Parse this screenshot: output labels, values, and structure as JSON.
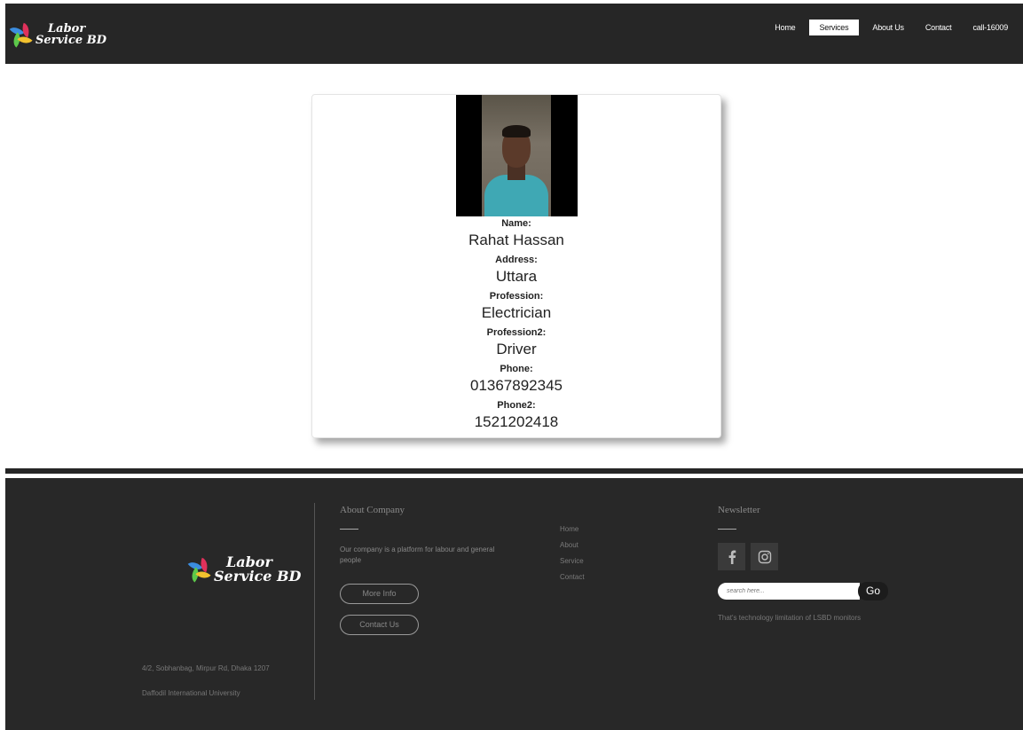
{
  "header": {
    "logo": {
      "line1": "Labor",
      "line2": "Service BD"
    },
    "nav": [
      {
        "label": "Home"
      },
      {
        "label": "Services"
      },
      {
        "label": "About Us"
      },
      {
        "label": "Contact"
      },
      {
        "label": "call-16009"
      }
    ],
    "active_nav": "Services"
  },
  "profile": {
    "photo_alt": "worker-photo",
    "fields": [
      {
        "label": "Name:",
        "value": "Rahat Hassan"
      },
      {
        "label": "Address:",
        "value": "Uttara"
      },
      {
        "label": "Profession:",
        "value": "Electrician"
      },
      {
        "label": "Profession2:",
        "value": "Driver"
      },
      {
        "label": "Phone:",
        "value": "01367892345"
      },
      {
        "label": "Phone2:",
        "value": "1521202418"
      }
    ]
  },
  "footer": {
    "logo": {
      "line1": "Labor",
      "line2": "Service BD"
    },
    "address": "4/2, Sobhanbag, Mirpur Rd, Dhaka 1207",
    "university": "Daffodil International University",
    "about": {
      "title": "About Company",
      "text": "Our company is a platform for labour and general people",
      "more_info": "More Info",
      "contact_us": "Contact Us"
    },
    "links": [
      "Home",
      "About",
      "Service",
      "Contact"
    ],
    "newsletter": {
      "title": "Newsletter",
      "search_placeholder": "search here...",
      "go_label": "Go",
      "note": "That's technology limitation of LSBD monitors"
    }
  },
  "colors": {
    "header_bg": "#262626",
    "footer_bg": "#282828",
    "leaf_blue": "#3b8de0",
    "leaf_red": "#e0315b",
    "leaf_green": "#5cc84a",
    "leaf_yellow": "#f2c12e"
  }
}
